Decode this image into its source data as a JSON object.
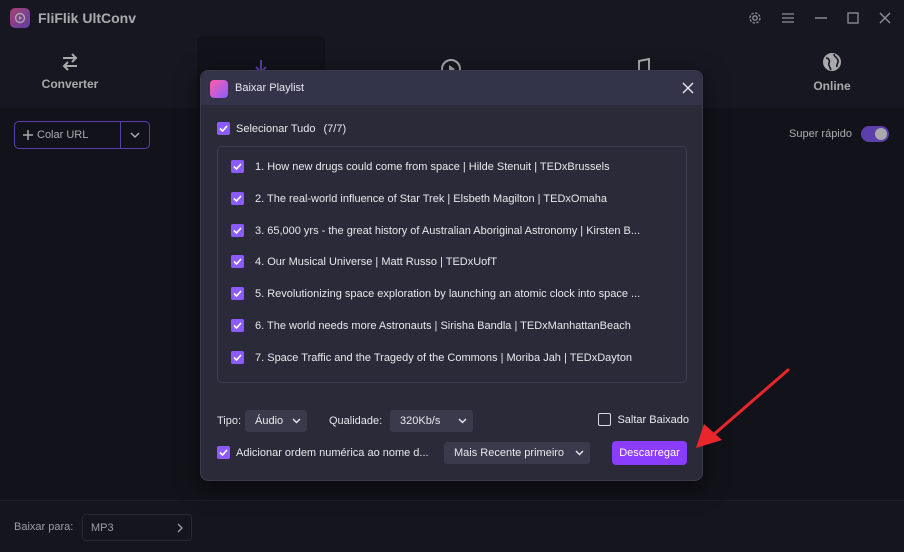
{
  "app": {
    "title": "FliFlik UltConv"
  },
  "nav": {
    "tabs": [
      {
        "label": "Converter",
        "icon": "convert-arrows-icon"
      },
      {
        "label": "",
        "icon": "download-icon"
      },
      {
        "label": "",
        "icon": "play-circle-icon"
      },
      {
        "label": "",
        "icon": "music-note-icon"
      },
      {
        "label": "Online",
        "icon": "globe-icon"
      }
    ]
  },
  "toolbar": {
    "paste_url_label": "Colar URL",
    "super_fast_label": "Super rápido",
    "super_fast_on": true
  },
  "bottom": {
    "download_to_label": "Baixar para:",
    "format_value": "MP3"
  },
  "dialog": {
    "title": "Baixar Playlist",
    "select_all_label": "Selecionar Tudo",
    "select_all_count": "(7/7)",
    "items": [
      {
        "label": "1. How new drugs could come from space | Hilde Stenuit | TEDxBrussels",
        "checked": true
      },
      {
        "label": "2. The real-world influence of Star Trek | Elsbeth Magilton | TEDxOmaha",
        "checked": true
      },
      {
        "label": "3. 65,000 yrs - the great history of Australian Aboriginal Astronomy | Kirsten B...",
        "checked": true
      },
      {
        "label": "4. Our Musical Universe | Matt Russo | TEDxUofT",
        "checked": true
      },
      {
        "label": "5. Revolutionizing space exploration by launching an atomic clock into space ...",
        "checked": true
      },
      {
        "label": "6. The world needs more Astronauts | Sirisha Bandla | TEDxManhattanBeach",
        "checked": true
      },
      {
        "label": "7. Space Traffic and the Tragedy of the Commons | Moriba Jah | TEDxDayton",
        "checked": true
      }
    ],
    "type_label": "Tipo:",
    "type_value": "Áudio",
    "quality_label": "Qualidade:",
    "quality_value": "320Kb/s",
    "skip_label": "Saltar Baixado",
    "skip_checked": false,
    "order_label": "Adicionar ordem numérica ao nome d...",
    "order_checked": true,
    "sort_value": "Mais Recente primeiro",
    "download_button": "Descarregar"
  },
  "colors": {
    "accent": "#8a5cff",
    "button": "#8a3cff",
    "annotation_arrow": "#e8262b"
  }
}
